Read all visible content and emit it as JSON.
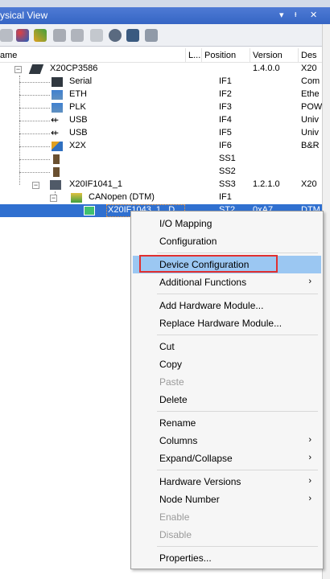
{
  "panel": {
    "title": "ysical View",
    "controls": [
      "▾",
      "ᵻ",
      "✕"
    ]
  },
  "columns": {
    "name": "ame",
    "l": "L...",
    "position": "Position",
    "version": "Version",
    "description": "Des"
  },
  "tree": [
    {
      "name": "X20CP3586",
      "position": "",
      "version": "1.4.0.0",
      "description": "X20",
      "icon": "cpu-icon"
    },
    {
      "name": "Serial",
      "position": "IF1",
      "version": "",
      "description": "Com",
      "icon": "serial-icon"
    },
    {
      "name": "ETH",
      "position": "IF2",
      "version": "",
      "description": "Ethe",
      "icon": "network-icon"
    },
    {
      "name": "PLK",
      "position": "IF3",
      "version": "",
      "description": "POW",
      "icon": "network-icon"
    },
    {
      "name": "USB",
      "position": "IF4",
      "version": "",
      "description": "Univ",
      "icon": "usb-icon"
    },
    {
      "name": "USB",
      "position": "IF5",
      "version": "",
      "description": "Univ",
      "icon": "usb-icon"
    },
    {
      "name": "X2X",
      "position": "IF6",
      "version": "",
      "description": "B&R",
      "icon": "x2x-icon"
    },
    {
      "name": "",
      "position": "SS1",
      "version": "",
      "description": "",
      "icon": "slot-icon"
    },
    {
      "name": "",
      "position": "SS2",
      "version": "",
      "description": "",
      "icon": "slot-icon"
    },
    {
      "name": "X20IF1041_1",
      "position": "SS3",
      "version": "1.2.1.0",
      "description": "X20",
      "icon": "module-icon"
    },
    {
      "name": "CANopen (DTM)",
      "position": "IF1",
      "version": "",
      "description": "",
      "icon": "canopen-icon"
    },
    {
      "name": "X20IF1043_1...D...",
      "position": "ST2",
      "version": "0xA7",
      "description": "DTM",
      "icon": "device-icon"
    }
  ],
  "menu": {
    "items": [
      {
        "label": "I/O Mapping",
        "submenu": false,
        "disabled": false
      },
      {
        "label": "Configuration",
        "submenu": false,
        "disabled": false
      },
      {
        "label": "Device Configuration",
        "submenu": false,
        "disabled": false
      },
      {
        "label": "Additional Functions",
        "submenu": true,
        "disabled": false
      },
      {
        "label": "Add Hardware Module...",
        "submenu": false,
        "disabled": false
      },
      {
        "label": "Replace Hardware Module...",
        "submenu": false,
        "disabled": false
      },
      {
        "label": "Cut",
        "submenu": false,
        "disabled": false
      },
      {
        "label": "Copy",
        "submenu": false,
        "disabled": false
      },
      {
        "label": "Paste",
        "submenu": false,
        "disabled": true
      },
      {
        "label": "Delete",
        "submenu": false,
        "disabled": false
      },
      {
        "label": "Rename",
        "submenu": false,
        "disabled": false
      },
      {
        "label": "Columns",
        "submenu": true,
        "disabled": false
      },
      {
        "label": "Expand/Collapse",
        "submenu": true,
        "disabled": false
      },
      {
        "label": "Hardware Versions",
        "submenu": true,
        "disabled": false
      },
      {
        "label": "Node Number",
        "submenu": true,
        "disabled": false
      },
      {
        "label": "Enable",
        "submenu": false,
        "disabled": true
      },
      {
        "label": "Disable",
        "submenu": false,
        "disabled": true
      },
      {
        "label": "Properties...",
        "submenu": false,
        "disabled": false
      }
    ],
    "arrow": "›"
  },
  "colors": {
    "selection": "#3070d0",
    "menu_hover": "#9bc7f2",
    "highlight_box": "#e03030",
    "panel_title_bg": "#4f7bd5"
  }
}
